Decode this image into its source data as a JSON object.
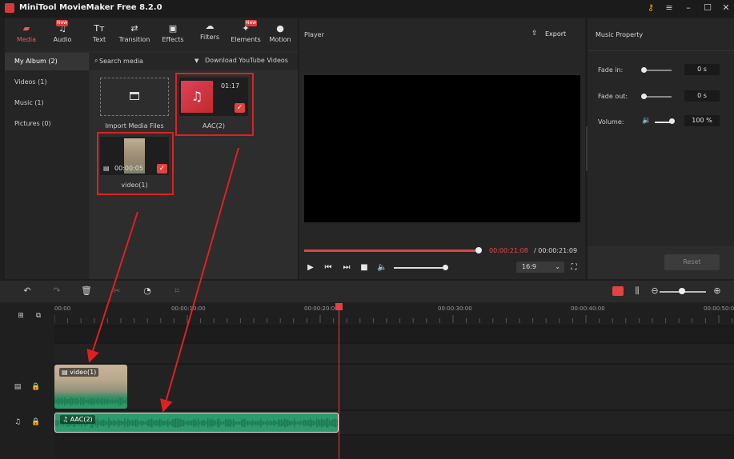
{
  "window": {
    "title": "MiniTool MovieMaker Free 8.2.0",
    "controls": [
      "key-icon",
      "menu-icon",
      "minimize-icon",
      "maximize-icon",
      "close-icon"
    ]
  },
  "toolbar": {
    "tabs": [
      {
        "label": "Media",
        "icon": "folder-icon",
        "active": true,
        "badge": ""
      },
      {
        "label": "Audio",
        "icon": "music-note-icon",
        "active": false,
        "badge": "New"
      },
      {
        "label": "Text",
        "icon": "text-icon",
        "active": false,
        "badge": ""
      },
      {
        "label": "Transition",
        "icon": "transition-icon",
        "active": false,
        "badge": ""
      },
      {
        "label": "Effects",
        "icon": "effects-icon",
        "active": false,
        "badge": ""
      },
      {
        "label": "Filters",
        "icon": "filters-icon",
        "active": false,
        "badge": ""
      },
      {
        "label": "Elements",
        "icon": "elements-icon",
        "active": false,
        "badge": "New"
      },
      {
        "label": "Motion",
        "icon": "motion-icon",
        "active": false,
        "badge": ""
      }
    ]
  },
  "sidebar": {
    "items": [
      {
        "label": "My Album (2)",
        "active": true
      },
      {
        "label": "Videos (1)",
        "active": false
      },
      {
        "label": "Music (1)",
        "active": false
      },
      {
        "label": "Pictures  (0)",
        "active": false
      }
    ]
  },
  "media": {
    "search_placeholder": "Search media",
    "download_label": "Download YouTube Videos",
    "import_label": "Import Media Files",
    "items": [
      {
        "name": "AAC(2)",
        "duration": "01:17",
        "checked": true
      },
      {
        "name": "video(1)",
        "duration": "00:00:05",
        "checked": true
      }
    ]
  },
  "player": {
    "title": "Player",
    "export_label": "Export",
    "current_time": "00:00:21:08",
    "total_time": " / 00:00:21:09",
    "progress": 1.0,
    "volume": 1.0,
    "aspect_ratio": "16:9"
  },
  "music_property": {
    "title": "Music Property",
    "fade_in_label": "Fade in:",
    "fade_in_value": "0 s",
    "fade_out_label": "Fade out:",
    "fade_out_value": "0 s",
    "volume_label": "Volume:",
    "volume_value": "100 %",
    "reset_label": "Reset"
  },
  "timeline": {
    "ruler": [
      "00:00",
      "00:00:10:00",
      "00:00:20:00",
      "00:00:30:00",
      "00:00:40:00",
      "00:00:50:00"
    ],
    "clips": [
      {
        "name": "video(1)",
        "track": "video"
      },
      {
        "name": "AAC(2)",
        "track": "audio"
      }
    ]
  },
  "colors": {
    "accent": "#e34242",
    "audio_clip": "#2c9b6c",
    "background": "#1e1e1e"
  }
}
